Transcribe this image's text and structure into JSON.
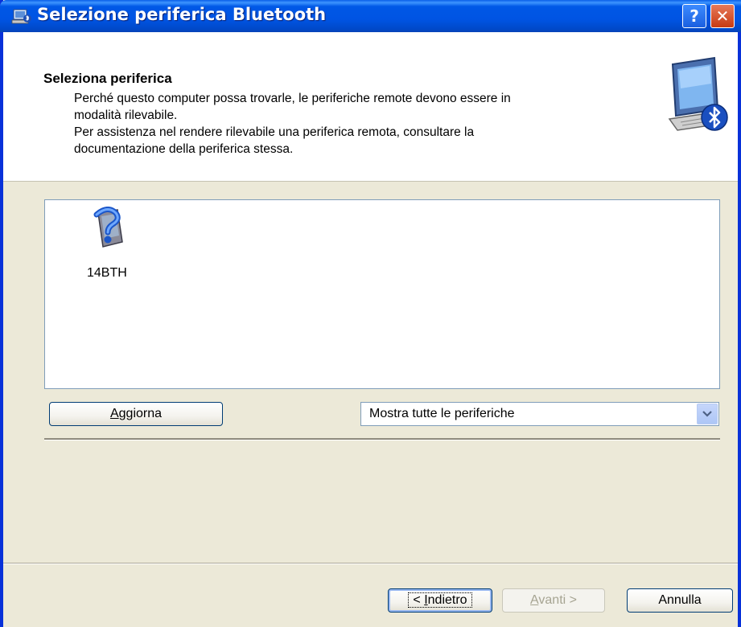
{
  "window": {
    "title": "Selezione periferica Bluetooth",
    "help_label": "?",
    "close_label": "✕"
  },
  "header": {
    "title": "Seleziona periferica",
    "lines": [
      "Perché questo computer possa trovarle, le periferiche remote devono essere in",
      "modalità rilevabile.",
      "Per assistenza nel rendere rilevabile una periferica remota, consultare la",
      "documentazione della periferica stessa."
    ]
  },
  "devices": [
    {
      "label": "14BTH",
      "icon": "unknown-device-icon"
    }
  ],
  "buttons": {
    "refresh_accel": "A",
    "refresh_rest": "ggiorna",
    "back_prefix": "< ",
    "back_accel": "I",
    "back_rest": "ndietro",
    "next_accel": "A",
    "next_rest": "vanti >",
    "cancel": "Annulla"
  },
  "filter": {
    "selected": "Mostra tutte le periferiche"
  },
  "colors": {
    "titlebar": "#0054e3",
    "dialog_bg": "#ece9d8",
    "border": "#0831d9"
  }
}
